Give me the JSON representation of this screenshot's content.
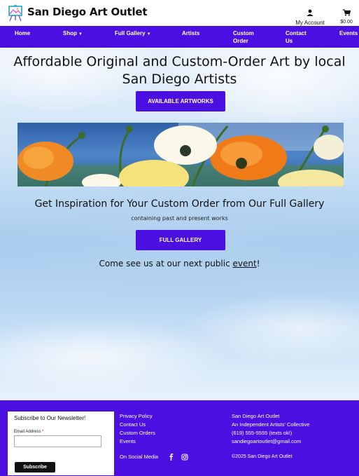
{
  "header": {
    "brand": "San Diego Art Outlet",
    "account_label": "My Account",
    "cart_total": "$0.00"
  },
  "nav": {
    "items": [
      {
        "label": "Home"
      },
      {
        "label": "Shop"
      },
      {
        "label": "Full Gallery"
      },
      {
        "label": "Artists"
      },
      {
        "label": "Custom\nOrder"
      },
      {
        "label": "Contact\nUs"
      },
      {
        "label": "Events"
      }
    ]
  },
  "main": {
    "hero_title": "Affordable Original and Custom-Order Art by local San Diego Artists",
    "artworks_button": "AVAILABLE ARTWORKS",
    "subtitle": "Get Inspiration for Your Custom Order from Our Full Gallery",
    "subsub": "containing past and present works",
    "gallery_button": "FULL GALLERY",
    "event_prefix": "Come see us at our next public ",
    "event_link": "event",
    "event_suffix": "!"
  },
  "footer": {
    "newsletter": {
      "title": "Subscribe to Our Newsletter!",
      "email_label": "Email Address",
      "required_mark": "*",
      "subscribe_button": "Subscribe"
    },
    "links": [
      "Privacy Policy",
      "Contact Us",
      "Custom Orders",
      "Events"
    ],
    "social_label": "On Social Media",
    "info": [
      "San Diego Art Outlet",
      "An Independent Artists' Collective",
      "(619) 555-5555 (texts ok!)",
      "sandiegoartoutlet@gmail.com"
    ],
    "copyright": "©2025 San Diego Art Outlet"
  },
  "colors": {
    "brand_purple": "#4b0fe2",
    "footer_text": "#ffffff"
  },
  "icons": [
    "easel-logo-icon",
    "user-icon",
    "cart-icon",
    "facebook-icon",
    "instagram-icon"
  ]
}
